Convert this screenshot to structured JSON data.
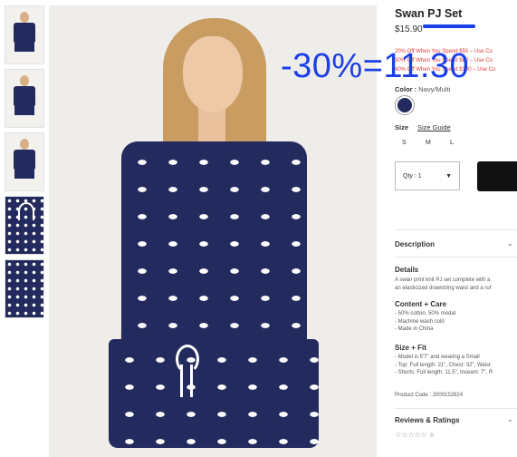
{
  "product": {
    "title": "Swan PJ Set",
    "price": "$15.90",
    "promo_overlay": "-30%=11.30",
    "offers": [
      "20% Off When You Spend $50 – Use Co",
      "30% Off When You Spend $80 – Use Co",
      "40% Off When You Spend $100 – Use Co"
    ],
    "color_label": "Color :",
    "color_value": "Navy/Multi",
    "size_label": "Size",
    "size_guide": "Size Guide",
    "sizes": [
      "S",
      "M",
      "L"
    ],
    "qty_label": "Qty : 1",
    "colors": {
      "navy": "#232a5e",
      "promo_blue": "#1a3fe6",
      "offer_red": "#e03a3a"
    }
  },
  "sections": {
    "description_title": "Description",
    "details_title": "Details",
    "details_text": [
      "A swan print knit PJ set complete with a",
      "an elasticized drawstring waist and a ruf"
    ],
    "content_title": "Content + Care",
    "content_lines": [
      "- 50% cotton, 50% modal",
      "- Machine wash cold",
      "- Made in China"
    ],
    "size_fit_title": "Size + Fit",
    "size_fit_lines": [
      "- Model is 5'7\" and wearing a Small",
      "- Top: Full length: 21\", Chest: 32\", Waist",
      "- Shorts: Full length: 11.5\", Inseam: 7\", R"
    ],
    "product_code": "Product Code : 2000152824",
    "reviews_title": "Reviews & Ratings",
    "stars": "☆☆☆☆☆",
    "review_count": "0"
  },
  "icons": {
    "chevron": "⌄"
  }
}
